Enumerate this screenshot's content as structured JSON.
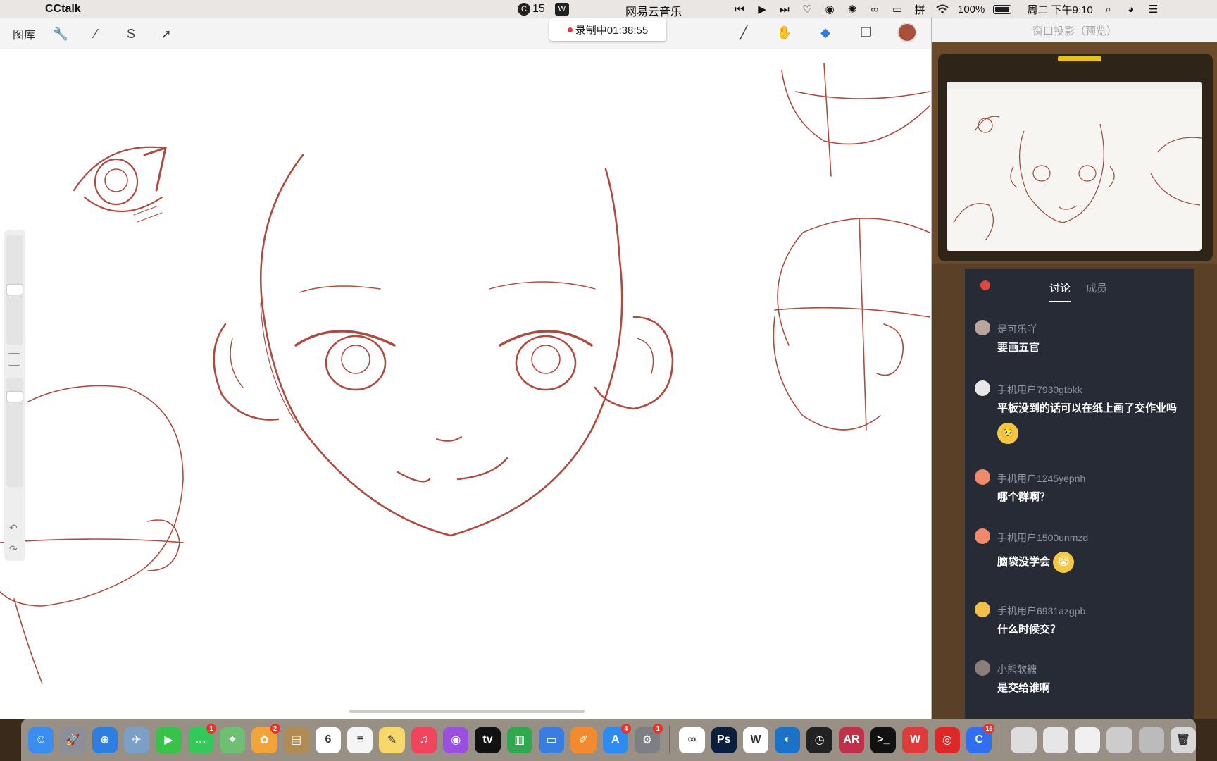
{
  "menubar": {
    "app_name": "CCtalk",
    "badge_count": "15",
    "music_app": "网易云音乐",
    "battery": "100%",
    "datetime": "周二 下午9:10"
  },
  "procreate": {
    "gallery_label": "图库",
    "recording_label": "录制中01:38:55"
  },
  "projection": {
    "title": "窗口投影（预览）"
  },
  "chat": {
    "tabs": [
      "讨论",
      "成员"
    ],
    "messages": [
      {
        "user": "是可乐吖",
        "text": "要画五官"
      },
      {
        "user": "手机用户7930gtbkk",
        "text": "平板没到的话可以在纸上画了交作业吗",
        "emoji": "🥺"
      },
      {
        "user": "手机用户1245yepnh",
        "text": "哪个群啊？"
      },
      {
        "user": "手机用户1500unmzd",
        "text": "脑袋没学会",
        "emoji": "😭"
      },
      {
        "user": "手机用户6931azgpb",
        "text": "什么时候交？"
      },
      {
        "user": "小熊软糖",
        "text": "是交给谁啊"
      }
    ]
  },
  "dock": {
    "apps": [
      {
        "name": "finder",
        "color": "#3b8df0",
        "glyph": "☺"
      },
      {
        "name": "launchpad",
        "color": "#8a8f99",
        "glyph": "🚀"
      },
      {
        "name": "safari",
        "color": "#2f7de1",
        "glyph": "⊕"
      },
      {
        "name": "preview",
        "color": "#7aa0c8",
        "glyph": "✈"
      },
      {
        "name": "facetime",
        "color": "#37c24a",
        "glyph": "▶"
      },
      {
        "name": "messages",
        "color": "#34c759",
        "glyph": "…",
        "badge": "1"
      },
      {
        "name": "maps",
        "color": "#6fbf73",
        "glyph": "⌖"
      },
      {
        "name": "photos",
        "color": "#f2a33a",
        "glyph": "✿",
        "badge": "2"
      },
      {
        "name": "notes-book",
        "color": "#b08b52",
        "glyph": "▤"
      },
      {
        "name": "calendar",
        "color": "#ffffff",
        "glyph": "6"
      },
      {
        "name": "reminders",
        "color": "#f5f5f5",
        "glyph": "≡"
      },
      {
        "name": "notes",
        "color": "#f7d96b",
        "glyph": "✎"
      },
      {
        "name": "music",
        "color": "#f0455d",
        "glyph": "♫"
      },
      {
        "name": "podcasts",
        "color": "#9b4fe0",
        "glyph": "◉"
      },
      {
        "name": "tv",
        "color": "#111111",
        "glyph": "tv"
      },
      {
        "name": "numbers",
        "color": "#2fa84f",
        "glyph": "▥"
      },
      {
        "name": "keynote",
        "color": "#3a7de0",
        "glyph": "▭"
      },
      {
        "name": "pages",
        "color": "#f28b2d",
        "glyph": "✐"
      },
      {
        "name": "app-store",
        "color": "#2e8bf0",
        "glyph": "A",
        "badge": "4"
      },
      {
        "name": "system-preferences",
        "color": "#7d7f85",
        "glyph": "⚙",
        "badge": "1"
      },
      {
        "name": "baidu-netdisk",
        "color": "#ffffff",
        "glyph": "∞"
      },
      {
        "name": "photoshop",
        "color": "#0c1e3d",
        "glyph": "Ps"
      },
      {
        "name": "wps",
        "color": "#ffffff",
        "glyph": "W"
      },
      {
        "name": "qq-browser",
        "color": "#1a73c8",
        "glyph": "◐"
      },
      {
        "name": "clock",
        "color": "#222222",
        "glyph": "◷"
      },
      {
        "name": "ar-app",
        "color": "#c0304a",
        "glyph": "AR"
      },
      {
        "name": "terminal",
        "color": "#111111",
        "glyph": ">_"
      },
      {
        "name": "wps-office",
        "color": "#e03a3a",
        "glyph": "W"
      },
      {
        "name": "netease-music",
        "color": "#e02727",
        "glyph": "◎"
      },
      {
        "name": "cctalk",
        "color": "#2f6ff0",
        "glyph": "C",
        "badge": "15"
      },
      {
        "name": "window-1",
        "color": "#dddddd",
        "glyph": ""
      },
      {
        "name": "window-2",
        "color": "#e6e6e6",
        "glyph": ""
      },
      {
        "name": "window-3",
        "color": "#f0f0f0",
        "glyph": ""
      },
      {
        "name": "window-4",
        "color": "#cccccc",
        "glyph": ""
      },
      {
        "name": "window-5",
        "color": "#bbbbbb",
        "glyph": ""
      },
      {
        "name": "trash",
        "color": "#d8d8d8",
        "glyph": "🗑"
      }
    ]
  },
  "colors": {
    "sketch": "#b04a3e",
    "chat_bg": "#262b36",
    "brush_color": "#a8503a"
  }
}
